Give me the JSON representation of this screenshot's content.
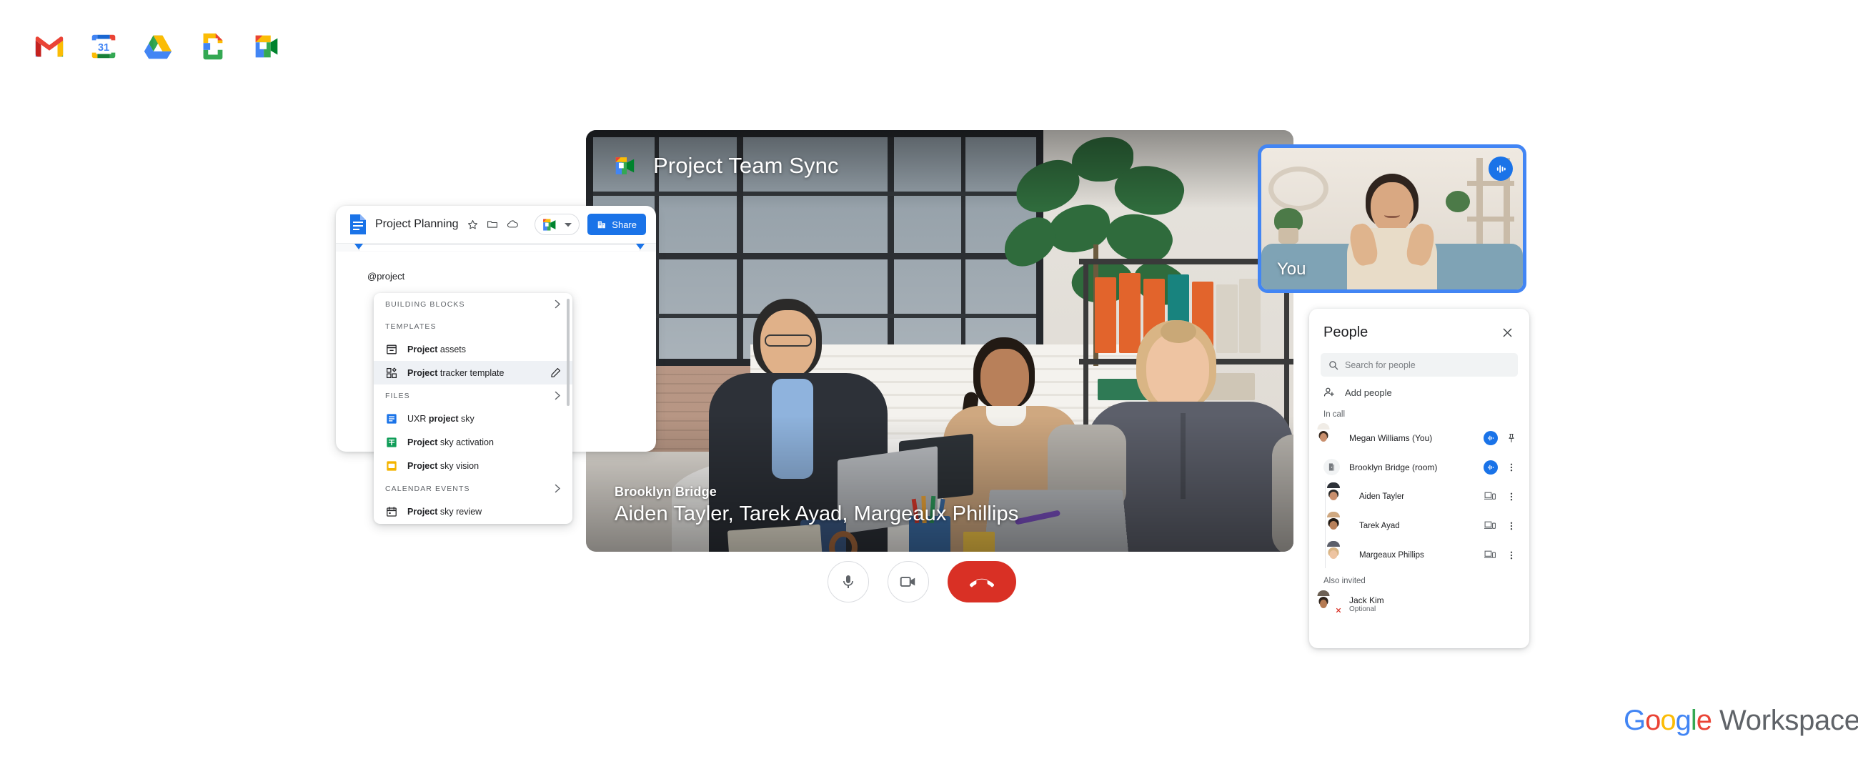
{
  "app_strip": {
    "icons": [
      {
        "name": "gmail-icon",
        "label": "Gmail"
      },
      {
        "name": "google-calendar-icon",
        "label": "Calendar",
        "day": "31"
      },
      {
        "name": "google-drive-icon",
        "label": "Drive"
      },
      {
        "name": "google-docs-icon",
        "label": "Docs"
      },
      {
        "name": "google-meet-icon",
        "label": "Meet"
      }
    ]
  },
  "meet": {
    "title": "Project Team Sync",
    "caption": {
      "room": "Brooklyn Bridge",
      "names": "Aiden Tayler, Tarek Ayad, Margeaux Phillips"
    },
    "selfview": {
      "label": "You",
      "badge": "audio-active",
      "border_color": "#4285F4"
    },
    "controls": [
      {
        "name": "microphone-button",
        "label": "Microphone",
        "state": "on"
      },
      {
        "name": "camera-button",
        "label": "Camera",
        "state": "on"
      },
      {
        "name": "end-call-button",
        "label": "Leave call",
        "color": "#d93025"
      }
    ]
  },
  "people_panel": {
    "title": "People",
    "close_label": "Close",
    "search": {
      "placeholder": "Search for people"
    },
    "add_people": "Add people",
    "sections": [
      {
        "label": "In call",
        "people": [
          {
            "name": "Megan Williams (You)",
            "nested": false,
            "avatar": "photo",
            "mic": true,
            "action": "pin"
          },
          {
            "name": "Brooklyn Bridge (room)",
            "nested": false,
            "avatar": "room",
            "mic": true,
            "action": "more"
          },
          {
            "name": "Aiden Tayler",
            "nested": true,
            "avatar": "photo-green",
            "mic": false,
            "action": "more",
            "device": true
          },
          {
            "name": "Tarek Ayad",
            "nested": true,
            "avatar": "photo-blue",
            "mic": false,
            "action": "more",
            "device": true
          },
          {
            "name": "Margeaux Phillips",
            "nested": true,
            "avatar": "photo-tan",
            "mic": false,
            "action": "more",
            "device": true
          }
        ]
      },
      {
        "label": "Also invited",
        "people": [
          {
            "name": "Jack Kim",
            "sub": "Optional",
            "nested": false,
            "avatar": "photo-declined",
            "declined": true
          }
        ]
      }
    ]
  },
  "docs": {
    "title": "Project Planning",
    "header_icons": [
      "star-icon",
      "folder-icon",
      "cloud-icon"
    ],
    "meet_button": "meet-pill",
    "share_label": "Share",
    "body_text": "@project"
  },
  "dropdown": {
    "groups": [
      {
        "type": "section",
        "label": "BUILDING BLOCKS",
        "chevron": true
      },
      {
        "type": "section",
        "label": "TEMPLATES",
        "chevron": false
      },
      {
        "type": "item",
        "icon": "template-card-icon",
        "bold": "Project",
        "rest": " assets",
        "active": false
      },
      {
        "type": "item",
        "icon": "grid-blocks-icon",
        "bold": "Project",
        "rest": " tracker template",
        "active": true,
        "trailing": "pencil-icon"
      },
      {
        "type": "section",
        "label": "FILES",
        "chevron": true
      },
      {
        "type": "item",
        "icon": "docs-file-icon",
        "pre": "UXR ",
        "bold": "project",
        "rest": " sky",
        "active": false
      },
      {
        "type": "item",
        "icon": "sheets-file-icon",
        "bold": "Project",
        "rest": " sky activation",
        "active": false
      },
      {
        "type": "item",
        "icon": "slides-file-icon",
        "bold": "Project",
        "rest": " sky vision",
        "active": false
      },
      {
        "type": "section",
        "label": "CALENDAR EVENTS",
        "chevron": true
      },
      {
        "type": "item",
        "icon": "calendar-event-icon",
        "bold": "Project",
        "rest": " sky review",
        "active": false
      }
    ]
  },
  "wordmark": {
    "g1": "G",
    "o1": "o",
    "o2": "o",
    "g2": "g",
    "l": "l",
    "e": "e",
    "workspace": "Workspace"
  },
  "colors": {
    "blue": "#4285F4",
    "red": "#EA4335",
    "yellow": "#FBBC05",
    "green": "#34A853",
    "docs_blue": "#1a73e8",
    "end_red": "#d93025"
  }
}
